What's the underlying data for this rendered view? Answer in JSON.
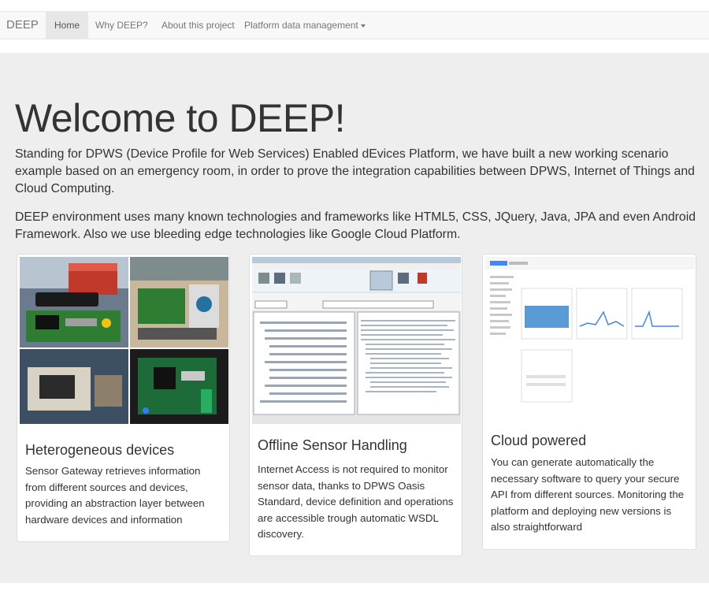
{
  "navbar": {
    "brand": "DEEP",
    "items": [
      {
        "label": "Home",
        "active": true
      },
      {
        "label": "Why DEEP?"
      },
      {
        "label": "About this project"
      },
      {
        "label": "Platform data management",
        "dropdown": true
      }
    ]
  },
  "jumbotron": {
    "title": "Welcome to DEEP!",
    "lead1": "Standing for DPWS (Device Profile for Web Services) Enabled dEvices Platform, we have built a new working scenario example based on an emergency room, in order to prove the integration capabilities between DPWS, Internet of Things and Cloud Computing.",
    "lead2": "DEEP environment uses many known technologies and frameworks like HTML5, CSS, JQuery, Java, JPA and even Android Framework. Also we use bleeding edge technologies like Google Cloud Platform."
  },
  "cards": [
    {
      "title": "Heterogeneous devices",
      "text": "Sensor Gateway retrieves information from different sources and devices, providing an abstraction layer between hardware devices and information",
      "image": "hardware-devices-photo"
    },
    {
      "title": "Offline Sensor Handling",
      "text": "Internet Access is not required to monitor sensor data, thanks to DPWS Oasis Standard, device definition and operations are accessible trough automatic WSDL discovery.",
      "image": "dpws-explorer-screenshot"
    },
    {
      "title": "Cloud powered",
      "text": "You can generate automatically the necessary software to query your secure API from different sources. Monitoring the platform and deploying new versions is also straightforward",
      "image": "google-cloud-console-screenshot"
    }
  ],
  "colors": {
    "navbar_bg": "#f8f8f8",
    "jumbotron_bg": "#eeeeee",
    "text": "#333333",
    "nav_text": "#777777"
  }
}
